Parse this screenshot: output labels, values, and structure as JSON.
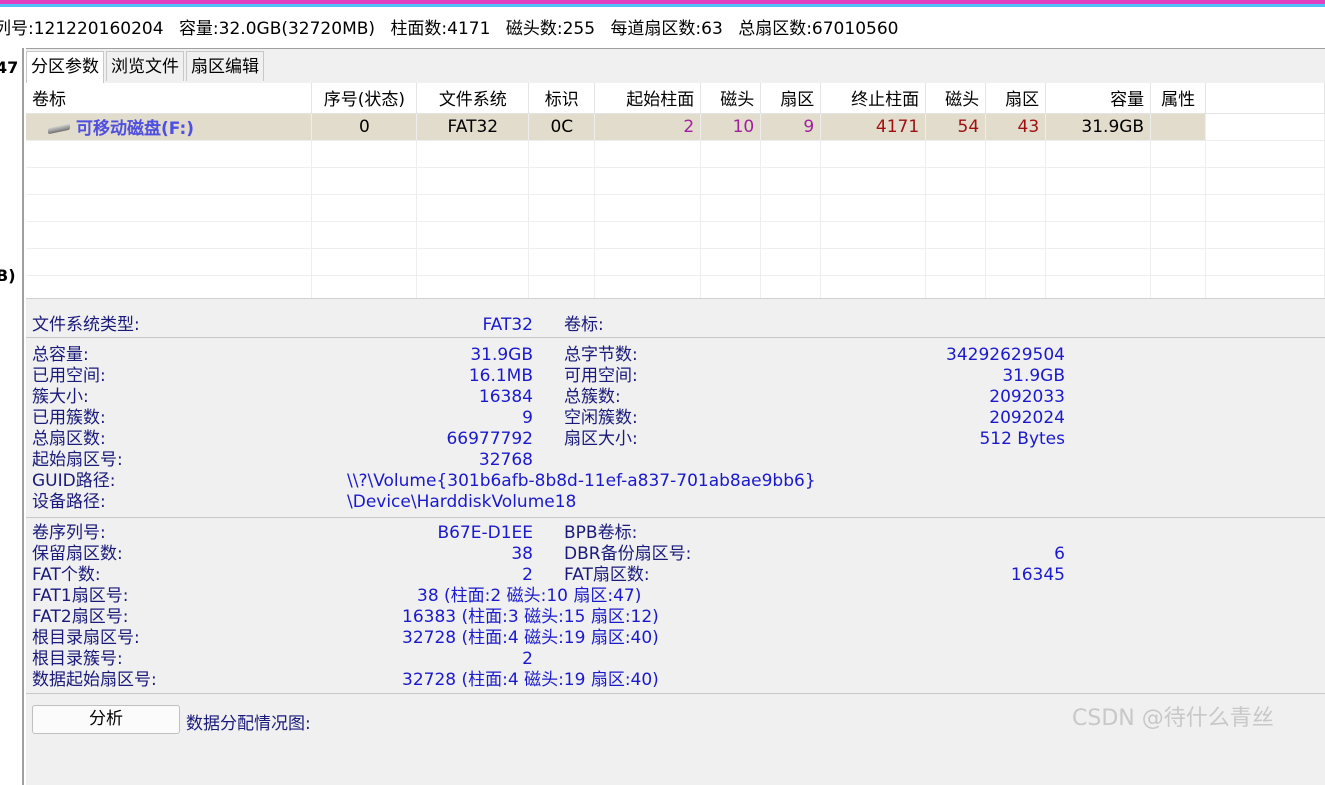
{
  "disk_info": {
    "serial": "列号:121220160204",
    "capacity": "容量:32.0GB(32720MB)",
    "cylinders": "柱面数:4171",
    "heads": "磁头数:255",
    "sectors_per_track": "每道扇区数:63",
    "total_sectors": "总扇区数:67010560"
  },
  "left_strip": {
    "frag1": "47",
    "frag2": "B)"
  },
  "tabs": [
    {
      "label": "分区参数"
    },
    {
      "label": "浏览文件"
    },
    {
      "label": "扇区编辑"
    }
  ],
  "table": {
    "headers": [
      "卷标",
      "序号(状态)",
      "文件系统",
      "标识",
      "起始柱面",
      "磁头",
      "扇区",
      "终止柱面",
      "磁头",
      "扇区",
      "容量",
      "属性"
    ],
    "rows": [
      {
        "volume": "可移动磁盘(F:)",
        "index": "0",
        "fs": "FAT32",
        "id": "0C",
        "start_cyl": "2",
        "start_head": "10",
        "start_sector": "9",
        "end_cyl": "4171",
        "end_head": "54",
        "end_sector": "43",
        "capacity": "31.9GB",
        "attr": ""
      }
    ]
  },
  "details": {
    "fs_type_label": "文件系统类型:",
    "fs_type_value": "FAT32",
    "volume_label_label": "卷标:",
    "total_cap_label": "总容量:",
    "total_cap_value": "31.9GB",
    "total_bytes_label": "总字节数:",
    "total_bytes_value": "34292629504",
    "used_space_label": "已用空间:",
    "used_space_value": "16.1MB",
    "free_space_label": "可用空间:",
    "free_space_value": "31.9GB",
    "cluster_size_label": "簇大小:",
    "cluster_size_value": "16384",
    "total_clusters_label": "总簇数:",
    "total_clusters_value": "2092033",
    "used_clusters_label": "已用簇数:",
    "used_clusters_value": "9",
    "free_clusters_label": "空闲簇数:",
    "free_clusters_value": "2092024",
    "total_sectors_label": "总扇区数:",
    "total_sectors_value": "66977792",
    "sector_size_label": "扇区大小:",
    "sector_size_value": "512 Bytes",
    "start_sector_label": "起始扇区号:",
    "start_sector_value": "32768",
    "guid_label": "GUID路径:",
    "guid_value": "\\\\?\\Volume{301b6afb-8b8d-11ef-a837-701ab8ae9bb6}",
    "device_label": "设备路径:",
    "device_value": "\\Device\\HarddiskVolume18",
    "serial_label": "卷序列号:",
    "serial_value": "B67E-D1EE",
    "bpb_label": "BPB卷标:",
    "reserved_label": "保留扇区数:",
    "reserved_value": "38",
    "dbr_backup_label": "DBR备份扇区号:",
    "dbr_backup_value": "6",
    "fat_count_label": "FAT个数:",
    "fat_count_value": "2",
    "fat_sectors_label": "FAT扇区数:",
    "fat_sectors_value": "16345",
    "fat1_label": "FAT1扇区号:",
    "fat1_value": "38 (柱面:2 磁头:10 扇区:47)",
    "fat2_label": "FAT2扇区号:",
    "fat2_value": "16383 (柱面:3 磁头:15 扇区:12)",
    "root_sector_label": "根目录扇区号:",
    "root_sector_value": "32728 (柱面:4 磁头:19 扇区:40)",
    "root_cluster_label": "根目录簇号:",
    "root_cluster_value": "2",
    "data_start_label": "数据起始扇区号:",
    "data_start_value": "32728 (柱面:4 磁头:19 扇区:40)"
  },
  "analyze_button": "分析",
  "distribution_label": "数据分配情况图:",
  "watermark": "CSDN @待什么青丝",
  "colors": {
    "accent_pink": "#e040c0",
    "accent_cyan": "#4fc3f7",
    "value_blue": "#1a1acc",
    "start_purple": "#a020a0",
    "end_red": "#a01010",
    "selected_row": "#e1dccc"
  }
}
